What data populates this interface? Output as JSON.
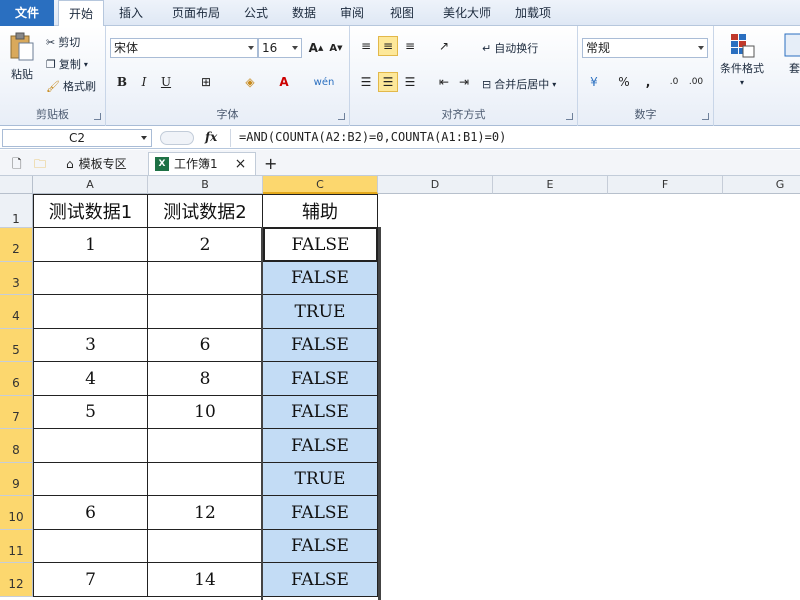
{
  "ribbon": {
    "tabs": [
      "文件",
      "开始",
      "插入",
      "页面布局",
      "公式",
      "数据",
      "审阅",
      "视图",
      "美化大师",
      "加载项"
    ],
    "active_tab": "开始",
    "clipboard": {
      "paste": "粘贴",
      "cut": "剪切",
      "copy": "复制",
      "format_painter": "格式刷",
      "label": "剪贴板"
    },
    "font": {
      "name": "宋体",
      "size": "16",
      "bold": "B",
      "italic": "I",
      "underline": "U",
      "label": "字体"
    },
    "alignment": {
      "wrap": "自动换行",
      "merge": "合并后居中",
      "label": "对齐方式"
    },
    "number": {
      "format": "常规",
      "percent": "%",
      "comma": ",",
      "label": "数字"
    },
    "styles": {
      "conditional": "条件格式",
      "table": "套用表格格"
    }
  },
  "formula_bar": {
    "name_box": "C2",
    "fx": "fx",
    "formula": "=AND(COUNTA(A2:B2)=0,COUNTA(A1:B1)=0)"
  },
  "workbook_tabs": {
    "template": "模板专区",
    "book": "工作簿1",
    "close": "×",
    "add": "+"
  },
  "sheet": {
    "columns": [
      "A",
      "B",
      "C",
      "D",
      "E",
      "F",
      "G"
    ],
    "headers": [
      "测试数据1",
      "测试数据2",
      "辅助"
    ],
    "rows": [
      {
        "n": "1",
        "a": "测试数据1",
        "b": "测试数据2",
        "c": "辅助"
      },
      {
        "n": "2",
        "a": "1",
        "b": "2",
        "c": "FALSE"
      },
      {
        "n": "3",
        "a": "",
        "b": "",
        "c": "FALSE"
      },
      {
        "n": "4",
        "a": "",
        "b": "",
        "c": "TRUE"
      },
      {
        "n": "5",
        "a": "3",
        "b": "6",
        "c": "FALSE"
      },
      {
        "n": "6",
        "a": "4",
        "b": "8",
        "c": "FALSE"
      },
      {
        "n": "7",
        "a": "5",
        "b": "10",
        "c": "FALSE"
      },
      {
        "n": "8",
        "a": "",
        "b": "",
        "c": "FALSE"
      },
      {
        "n": "9",
        "a": "",
        "b": "",
        "c": "TRUE"
      },
      {
        "n": "10",
        "a": "6",
        "b": "12",
        "c": "FALSE"
      },
      {
        "n": "11",
        "a": "",
        "b": "",
        "c": "FALSE"
      },
      {
        "n": "12",
        "a": "7",
        "b": "14",
        "c": "FALSE"
      }
    ]
  },
  "colors": {
    "selection": "#c3dcf5",
    "header_selected": "#fcd76e",
    "file_tab": "#2a6fc0"
  }
}
